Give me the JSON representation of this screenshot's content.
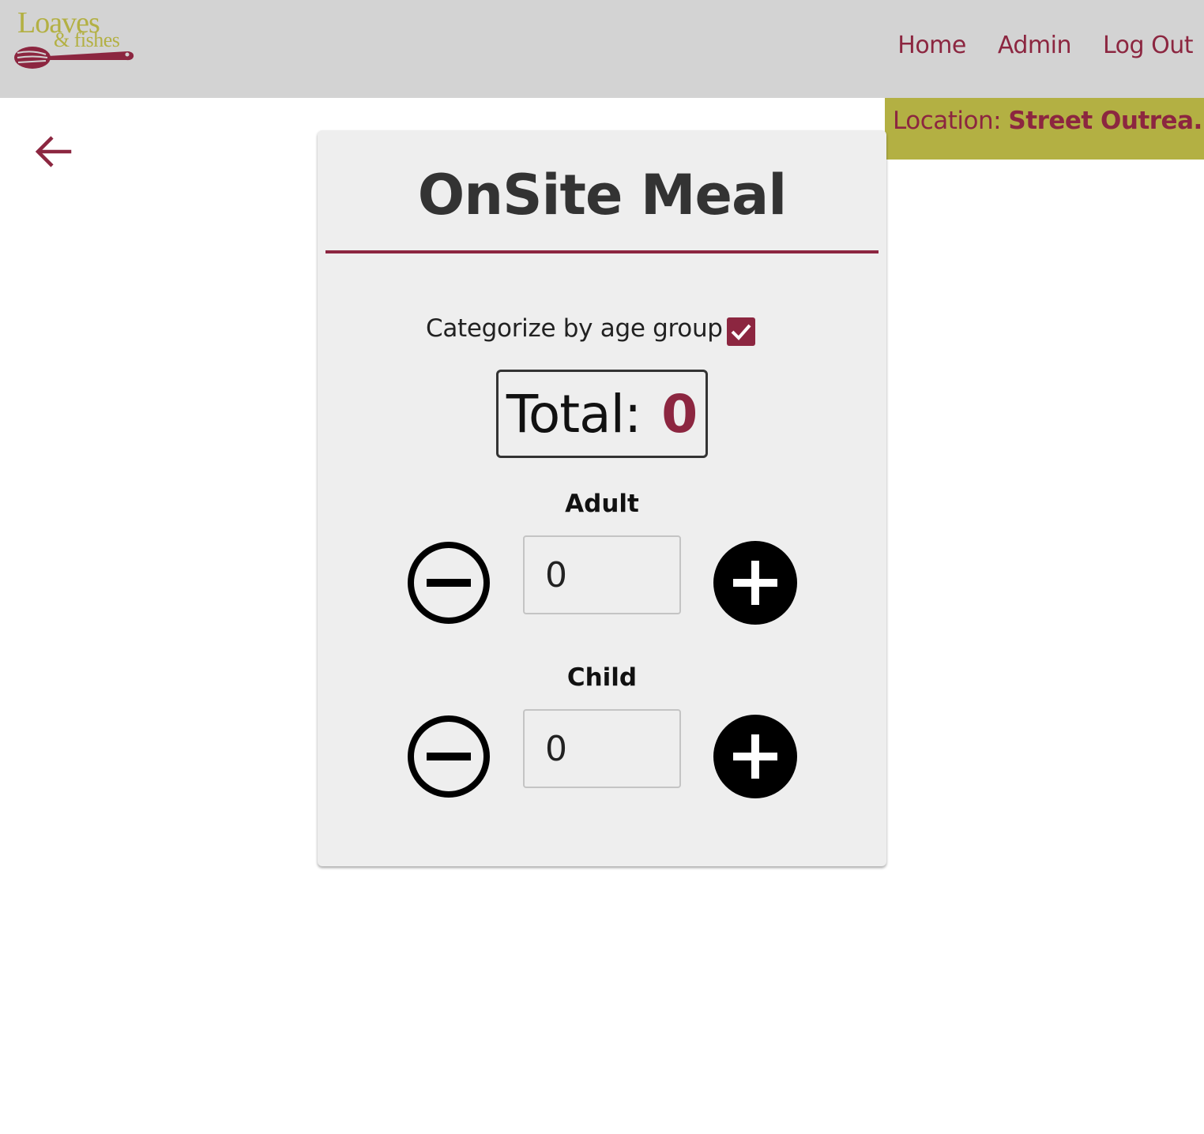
{
  "header": {
    "logo_line1": "Loaves",
    "logo_line2": "& fishes",
    "nav": {
      "home": "Home",
      "admin": "Admin",
      "logout": "Log Out"
    }
  },
  "location": {
    "label": "Location:",
    "value": "Street Outrea..."
  },
  "card": {
    "title": "OnSite Meal",
    "categorize_label": "Categorize by age group",
    "categorize_checked": true,
    "total_label": "Total:",
    "total_value": "0",
    "groups": [
      {
        "label": "Adult",
        "value": "0"
      },
      {
        "label": "Child",
        "value": "0"
      }
    ]
  },
  "colors": {
    "brand_maroon": "#8c2640",
    "brand_olive": "#b3b043",
    "header_bg": "#d3d3d3",
    "card_bg": "#eeeeee"
  },
  "icons": [
    "back-arrow-icon",
    "checkmark-icon",
    "minus-circle-icon",
    "plus-circle-icon",
    "spoon-icon"
  ]
}
